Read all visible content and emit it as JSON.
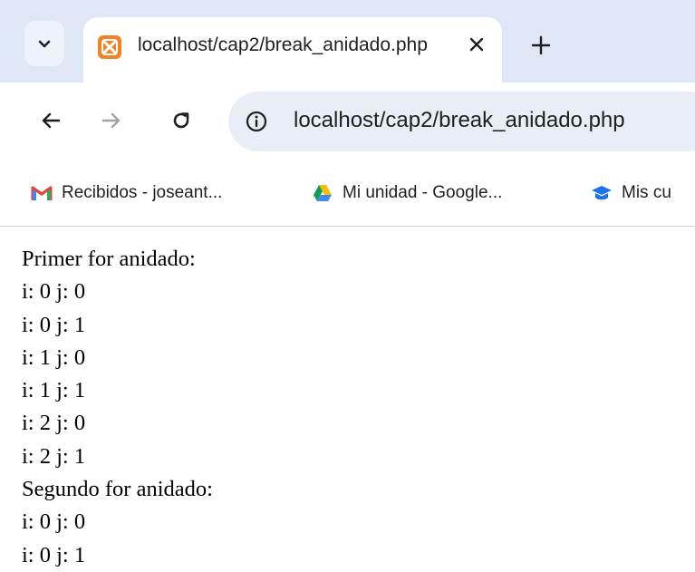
{
  "tab": {
    "title": "localhost/cap2/break_anidado.php"
  },
  "address_bar": {
    "url": "localhost/cap2/break_anidado.php"
  },
  "bookmarks": [
    {
      "label": "Recibidos - joseant...",
      "icon": "gmail-icon"
    },
    {
      "label": "Mi unidad - Google...",
      "icon": "google-drive-icon"
    },
    {
      "label": "Mis cu",
      "icon": "graduation-cap-icon"
    }
  ],
  "content": {
    "lines": [
      "Primer for anidado:",
      "i: 0 j: 0",
      "i: 0 j: 1",
      "i: 1 j: 0",
      "i: 1 j: 1",
      "i: 2 j: 0",
      "i: 2 j: 1",
      "Segundo for anidado:",
      "i: 0 j: 0",
      "i: 0 j: 1"
    ]
  },
  "colors": {
    "tabstrip": "#dfe7f6",
    "omnibox": "#e9eef6",
    "favicon": "#f08326"
  }
}
